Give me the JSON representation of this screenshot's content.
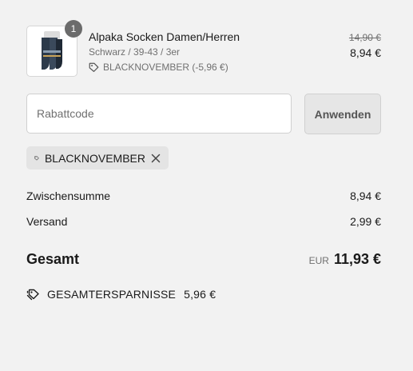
{
  "line_item": {
    "quantity": "1",
    "name": "Alpaka Socken Damen/Herren",
    "variant": "Schwarz / 39-43 / 3er",
    "discount": "BLACKNOVEMBER (-5,96 €)",
    "price_original": "14,90 €",
    "price_final": "8,94 €"
  },
  "discount_form": {
    "placeholder": "Rabattcode",
    "apply_label": "Anwenden"
  },
  "applied_code": {
    "label": "BLACKNOVEMBER"
  },
  "summary": {
    "subtotal_label": "Zwischensumme",
    "subtotal_value": "8,94 €",
    "shipping_label": "Versand",
    "shipping_value": "2,99 €",
    "total_label": "Gesamt",
    "total_currency": "EUR",
    "total_value": "11,93 €"
  },
  "savings": {
    "label": "GESAMTERSPARNISSE",
    "amount": "5,96 €"
  },
  "icons": {
    "product_image": "socks-product-image",
    "tag": "tag-icon",
    "remove": "close-icon",
    "savings": "tags-icon"
  }
}
